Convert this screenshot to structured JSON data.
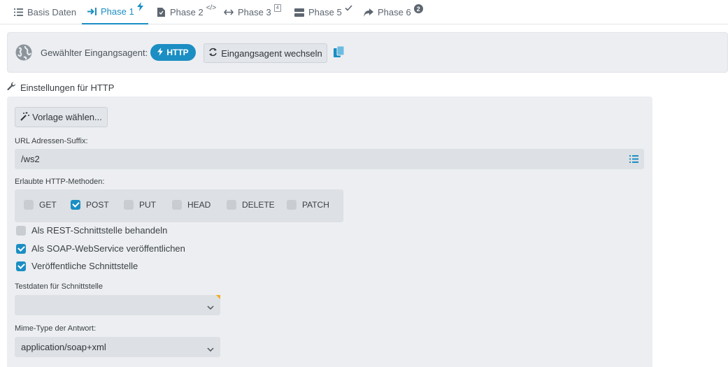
{
  "tabs": [
    {
      "label": "Basis Daten",
      "icon": "list-icon",
      "active": false
    },
    {
      "label": "Phase 1",
      "icon": "arrow-in-icon",
      "marker": "bolt-icon",
      "active": true
    },
    {
      "label": "Phase 2",
      "icon": "file-code-icon",
      "marker": "</>",
      "active": false
    },
    {
      "label": "Phase 3",
      "icon": "arrows-horizontal-icon",
      "marker": "4",
      "active": false
    },
    {
      "label": "Phase 5",
      "icon": "server-icon",
      "marker": "check-icon",
      "active": false
    },
    {
      "label": "Phase 6",
      "icon": "share-arrow-icon",
      "marker": "2",
      "active": false
    }
  ],
  "agent": {
    "label": "Gewählter Eingangsagent:",
    "selected": "HTTP",
    "switch_label": "Eingangsagent wechseln"
  },
  "settings": {
    "title": "Einstellungen für HTTP",
    "template_button": "Vorlage wählen...",
    "url_suffix_label": "URL Adressen-Suffix:",
    "url_suffix_value": "/ws2",
    "methods_label": "Erlaubte HTTP-Methoden:",
    "methods": [
      {
        "label": "GET",
        "checked": false
      },
      {
        "label": "POST",
        "checked": true
      },
      {
        "label": "PUT",
        "checked": false
      },
      {
        "label": "HEAD",
        "checked": false
      },
      {
        "label": "DELETE",
        "checked": false
      },
      {
        "label": "PATCH",
        "checked": false
      }
    ],
    "options": [
      {
        "label": "Als REST-Schnittstelle behandeln",
        "checked": false
      },
      {
        "label": "Als SOAP-WebService veröffentlichen",
        "checked": true
      },
      {
        "label": "Veröffentliche Schnittstelle",
        "checked": true
      }
    ],
    "testdata_label": "Testdaten für Schnittstelle",
    "testdata_value": "",
    "mime_label": "Mime-Type der Antwort:",
    "mime_value": "application/soap+xml"
  },
  "colors": {
    "accent": "#1b8ec3",
    "panel": "#eceef1",
    "field": "#dde0e4",
    "warning_corner": "#f0ad1b"
  }
}
